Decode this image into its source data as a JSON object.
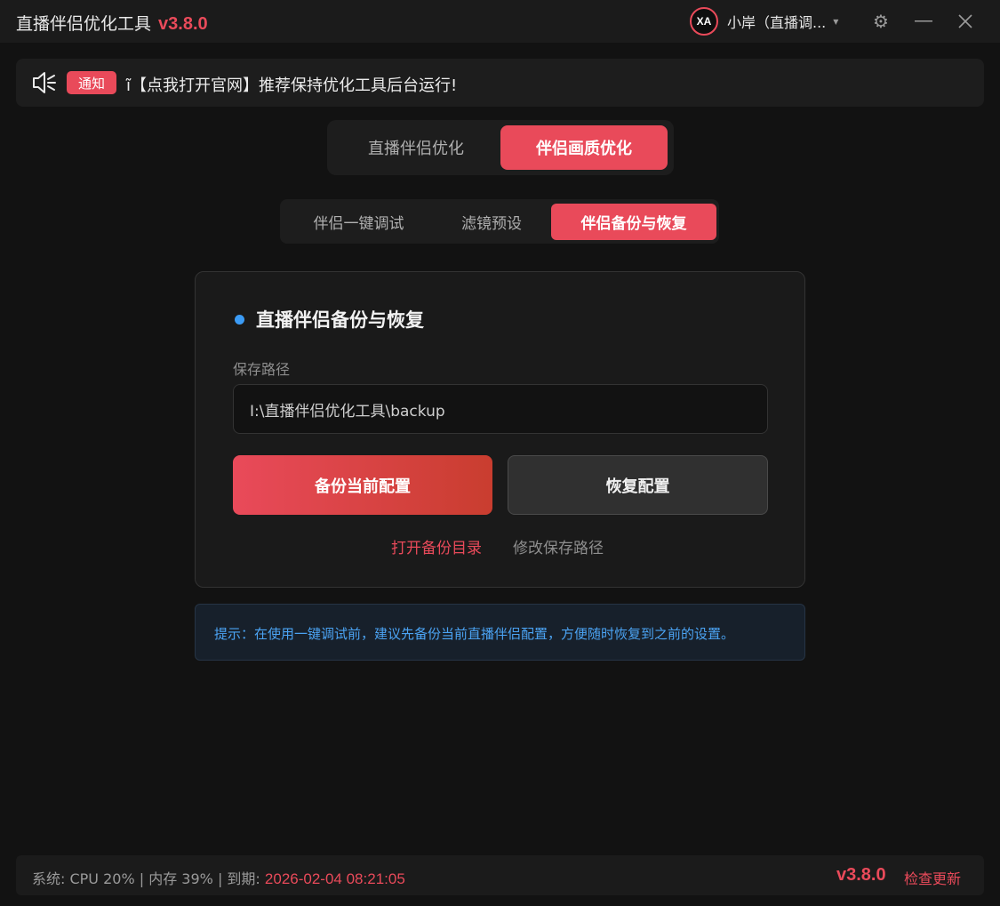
{
  "titlebar": {
    "title": "直播伴侣优化工具",
    "version": "v3.8.0",
    "avatar_text": "XA",
    "username": "小岸（直播调...",
    "icons": [
      "settings-gear-icon",
      "minimize-icon",
      "close-icon",
      "dropdown-caret-icon"
    ]
  },
  "notice": {
    "icon": "speaker-icon",
    "badge": "通知",
    "text": "ĩ【点我打开官网】推荐保持优化工具后台运行!"
  },
  "main_tabs": [
    {
      "label": "直播伴侣优化",
      "active": false
    },
    {
      "label": "伴侣画质优化",
      "active": true
    }
  ],
  "sub_tabs": [
    {
      "label": "伴侣一键调试",
      "active": false
    },
    {
      "label": "滤镜预设",
      "active": false
    },
    {
      "label": "伴侣备份与恢复",
      "active": true
    }
  ],
  "card": {
    "title": "直播伴侣备份与恢复",
    "path_label": "保存路径",
    "path_value": "I:\\直播伴侣优化工具\\backup",
    "backup_button": "备份当前配置",
    "restore_button": "恢复配置",
    "open_dir_link": "打开备份目录",
    "modify_path_link": "修改保存路径"
  },
  "tip": {
    "text": "提示：在使用一键调试前，建议先备份当前直播伴侣配置，方便随时恢复到之前的设置。"
  },
  "statusbar": {
    "system_text": "系统: CPU 20% | 内存 39% | 到期: ",
    "expiry": "2026-02-04 08:21:05",
    "version": "v3.8.0",
    "check_update": "检查更新"
  },
  "colors": {
    "accent": "#e94a5a",
    "background": "#121212",
    "panel": "#1d1d1d",
    "info_blue": "#4ba3f3"
  }
}
